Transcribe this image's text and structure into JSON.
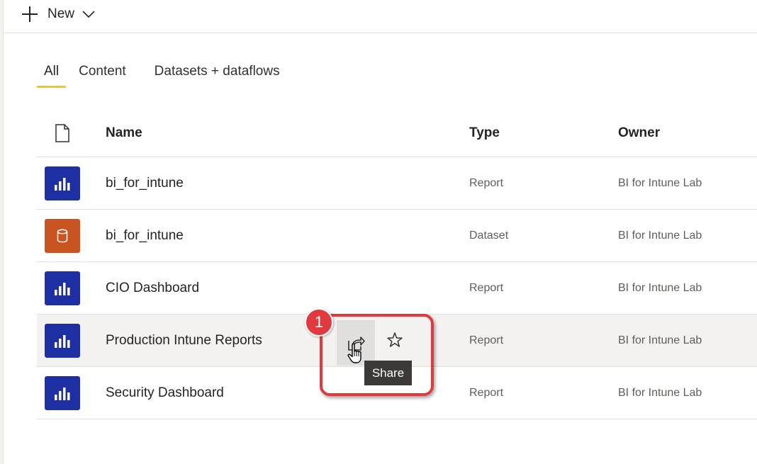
{
  "toolbar": {
    "new_label": "New",
    "new_icon": "plus-icon",
    "dropdown_icon": "chevron-down-icon"
  },
  "tabs": [
    {
      "label": "All",
      "active": true
    },
    {
      "label": "Content",
      "active": false
    },
    {
      "label": "Datasets + dataflows",
      "active": false
    }
  ],
  "table": {
    "columns": {
      "icon": "document-icon",
      "name": "Name",
      "type": "Type",
      "owner": "Owner"
    },
    "rows": [
      {
        "icon": "report-chart-icon",
        "name": "bi_for_intune",
        "type": "Report",
        "owner": "BI for Intune Lab"
      },
      {
        "icon": "dataset-cylinder-icon",
        "name": "bi_for_intune",
        "type": "Dataset",
        "owner": "BI for Intune Lab"
      },
      {
        "icon": "report-chart-icon",
        "name": "CIO Dashboard",
        "type": "Report",
        "owner": "BI for Intune Lab"
      },
      {
        "icon": "report-chart-icon",
        "name": "Production Intune Reports",
        "type": "Report",
        "owner": "BI for Intune Lab"
      },
      {
        "icon": "report-chart-icon",
        "name": "Security Dashboard",
        "type": "Report",
        "owner": "BI for Intune Lab"
      }
    ]
  },
  "row_actions": {
    "share_icon": "share-icon",
    "favorite_icon": "star-icon",
    "tooltip": "Share"
  },
  "annotation": {
    "step_number": "1"
  },
  "colors": {
    "report_tile": "#1e2fa3",
    "dataset_tile": "#c95422",
    "tab_underline": "#f2c811",
    "annotation_red": "#e0393e"
  }
}
